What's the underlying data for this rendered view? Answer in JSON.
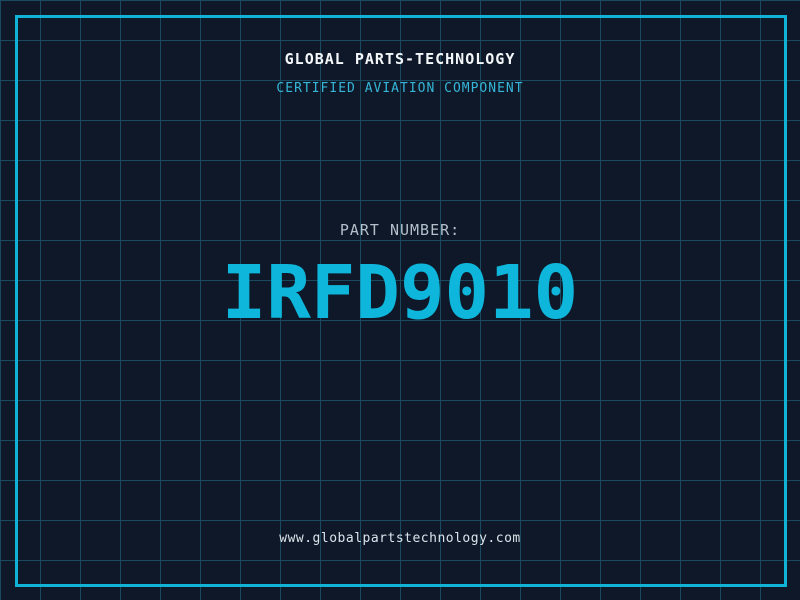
{
  "page": {
    "title": "GLOBAL PARTS-TECHNOLOGY",
    "subtitle": "CERTIFIED AVIATION COMPONENT",
    "part_label": "PART NUMBER:",
    "part_number": "IRFD9010",
    "website": "www.globalpartstechnology.com"
  },
  "theme": {
    "background": "#0f1828",
    "grid_line": "#1a4a5f",
    "frame_border": "#11b2d8",
    "accent_cyan": "#0db6da",
    "subtitle_color": "#35b6d8",
    "title_color": "#f4f7fa",
    "label_color": "#b3bfcb",
    "url_color": "#dbe4ec"
  },
  "layout_meta": {
    "grid_cell_px": "40"
  }
}
